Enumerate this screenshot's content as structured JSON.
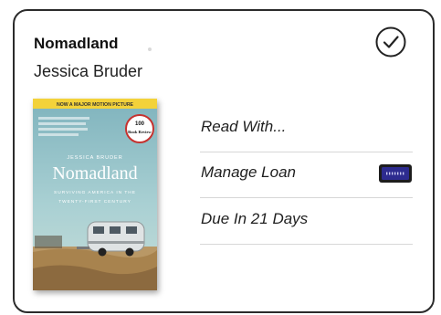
{
  "book": {
    "title": "Nomadland",
    "author": "Jessica Bruder",
    "cover": {
      "banner": "NOW A MAJOR MOTION PICTURE",
      "author_name": "JESSICA BRUDER",
      "title": "Nomadland",
      "subtitle_line1": "SURVIVING AMERICA IN THE",
      "subtitle_line2": "TWENTY-FIRST CENTURY",
      "badge_number": "100",
      "badge_label": "Book Review"
    }
  },
  "actions": {
    "read_with": "Read With...",
    "manage_loan": "Manage Loan",
    "due": "Due In 21 Days"
  },
  "icons": {
    "status": "check-circle-icon",
    "loan": "ereader-device-icon"
  },
  "colors": {
    "cover_sky": "#9cc7cc",
    "banner": "#f3d23a",
    "device_blue": "#2d2b8f"
  }
}
